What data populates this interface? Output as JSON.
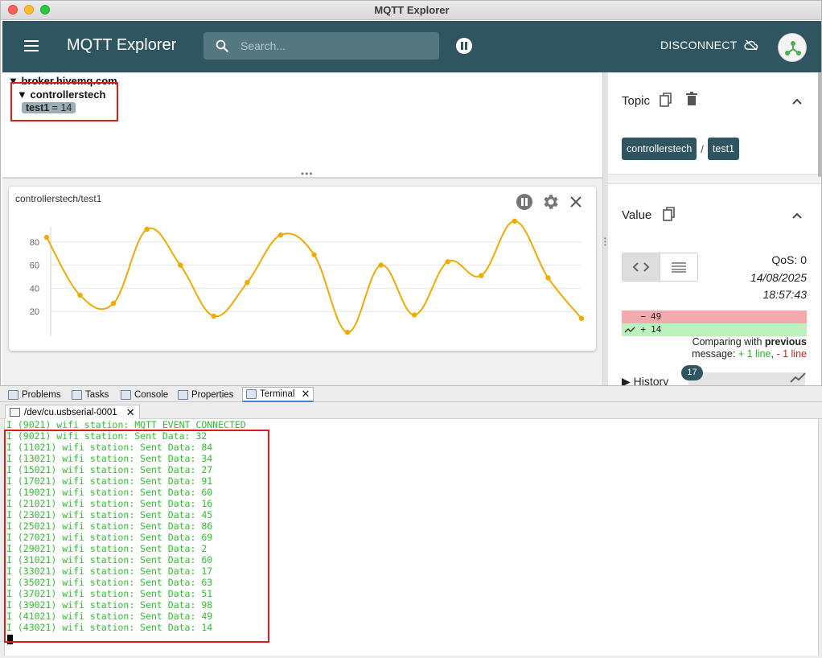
{
  "window": {
    "title": "MQTT Explorer"
  },
  "appbar": {
    "title": "MQTT Explorer",
    "search_placeholder": "Search...",
    "disconnect_label": "DISCONNECT"
  },
  "tree": {
    "root": "broker.hivemq.com",
    "child": "controllerstech",
    "leaf_name": "test1",
    "leaf_value": "= 14"
  },
  "chart": {
    "title": "controllerstech/test1",
    "y_ticks": [
      "80",
      "60",
      "40",
      "20"
    ]
  },
  "chart_data": {
    "type": "line",
    "title": "controllerstech/test1",
    "xlabel": "",
    "ylabel": "",
    "ylim": [
      0,
      100
    ],
    "series": [
      {
        "values": [
          84,
          34,
          27,
          91,
          60,
          16,
          45,
          86,
          69,
          2,
          60,
          17,
          63,
          51,
          98,
          49,
          14
        ],
        "color": "#f0ab00"
      }
    ]
  },
  "detail": {
    "topic_label": "Topic",
    "topic_chips": [
      "controllerstech",
      "test1"
    ],
    "topic_sep": "/",
    "value_label": "Value",
    "qos": "QoS: 0",
    "date": "14/08/2025",
    "time": "18:57:43",
    "diff_old": "49",
    "diff_new": "14",
    "diff_old_mark": "−",
    "diff_new_mark": "+",
    "compare_prefix": "Comparing with",
    "compare_bold": "previous",
    "compare_msg": "message:",
    "compare_plus": "+ 1 line",
    "compare_sep": ",",
    "compare_minus": "- 1 line",
    "history_label": "History",
    "history_count": "17"
  },
  "eclipse_tabs": [
    "Problems",
    "Tasks",
    "Console",
    "Properties",
    "Terminal"
  ],
  "terminal": {
    "tab_label": "/dev/cu.usbserial-0001",
    "lines": [
      "I (9021) wifi station: MQTT_EVENT_CONNECTED",
      "I (9021) wifi station: Sent Data: 32",
      "I (11021) wifi station: Sent Data: 84",
      "I (13021) wifi station: Sent Data: 34",
      "I (15021) wifi station: Sent Data: 27",
      "I (17021) wifi station: Sent Data: 91",
      "I (19021) wifi station: Sent Data: 60",
      "I (21021) wifi station: Sent Data: 16",
      "I (23021) wifi station: Sent Data: 45",
      "I (25021) wifi station: Sent Data: 86",
      "I (27021) wifi station: Sent Data: 69",
      "I (29021) wifi station: Sent Data: 2",
      "I (31021) wifi station: Sent Data: 60",
      "I (33021) wifi station: Sent Data: 17",
      "I (35021) wifi station: Sent Data: 63",
      "I (37021) wifi station: Sent Data: 51",
      "I (39021) wifi station: Sent Data: 98",
      "I (41021) wifi station: Sent Data: 49",
      "I (43021) wifi station: Sent Data: 14"
    ]
  }
}
